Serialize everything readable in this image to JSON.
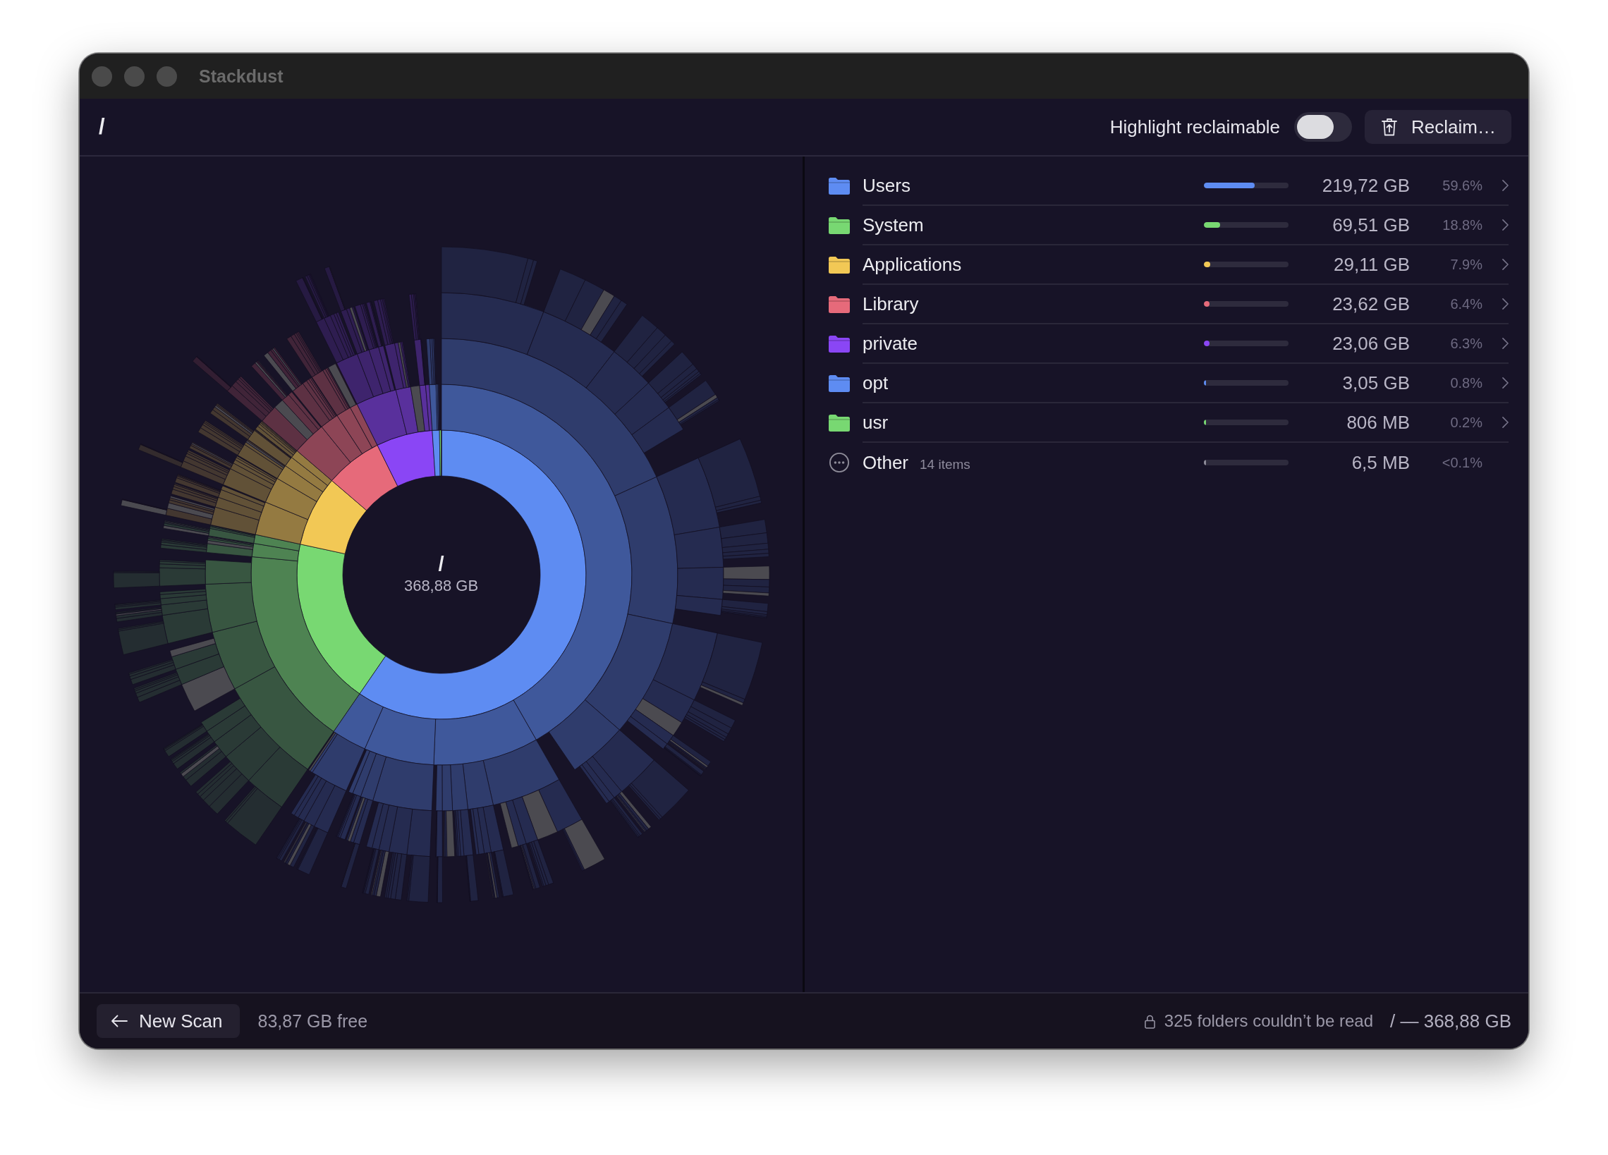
{
  "window": {
    "title": "Stackdust"
  },
  "toolbar": {
    "path": "/",
    "highlight_toggle": {
      "label": "Highlight reclaimable",
      "on": false
    },
    "reclaim_button": {
      "label": "Reclaim…"
    }
  },
  "sunburst": {
    "center_path": "/",
    "center_size": "368,88 GB"
  },
  "rows": [
    {
      "kind": "folder",
      "name": "Users",
      "color": "#5e8cf2",
      "level": 0.596,
      "size": "219,72 GB",
      "percent": "59.6%"
    },
    {
      "kind": "folder",
      "name": "System",
      "color": "#78d872",
      "level": 0.188,
      "size": "69,51 GB",
      "percent": "18.8%"
    },
    {
      "kind": "folder",
      "name": "Applications",
      "color": "#f2c855",
      "level": 0.079,
      "size": "29,11 GB",
      "percent": "7.9%"
    },
    {
      "kind": "folder",
      "name": "Library",
      "color": "#e66a7a",
      "level": 0.064,
      "size": "23,62 GB",
      "percent": "6.4%"
    },
    {
      "kind": "folder",
      "name": "private",
      "color": "#8a46f5",
      "level": 0.063,
      "size": "23,06 GB",
      "percent": "6.3%"
    },
    {
      "kind": "folder",
      "name": "opt",
      "color": "#5e8cf2",
      "level": 0.008,
      "size": "3,05 GB",
      "percent": "0.8%"
    },
    {
      "kind": "folder",
      "name": "usr",
      "color": "#78d872",
      "level": 0.002,
      "size": "806 MB",
      "percent": "0.2%"
    },
    {
      "kind": "other",
      "name": "Other",
      "count": "14 items",
      "color": "#8e8c99",
      "level": 0.0002,
      "size": "6,5 MB",
      "percent": "<0.1%"
    }
  ],
  "status_bar": {
    "new_scan_button": {
      "label": "New Scan"
    },
    "free_space": "83,87 GB free",
    "warning": "325 folders couldn’t be read",
    "summary": "/ — 368,88 GB"
  }
}
